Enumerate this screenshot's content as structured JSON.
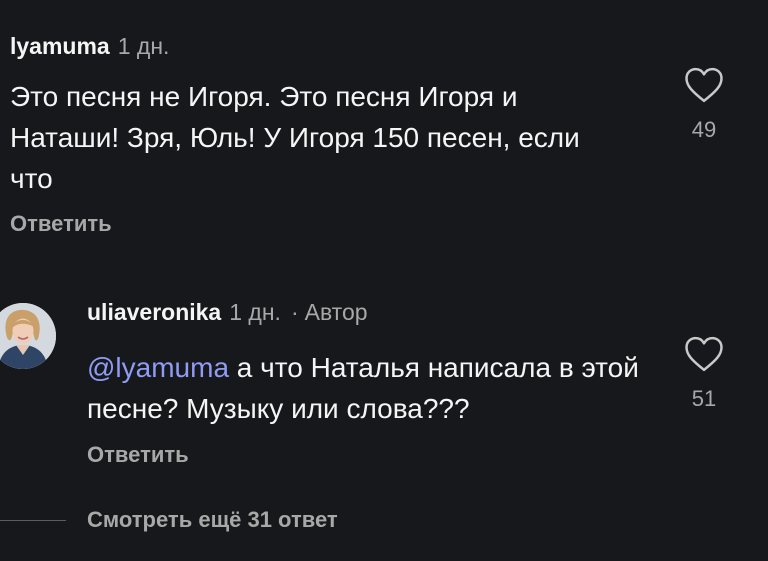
{
  "comments": [
    {
      "username": "lyamuma",
      "time": "1 дн.",
      "text": "Это песня не Игоря. Это песня Игоря и Наташи! Зря, Юль! У Игоря 150 песен, если что",
      "reply_label": "Ответить",
      "likes": "49",
      "icon": "heart-icon"
    },
    {
      "username": "uliaveronika",
      "time": "1 дн.",
      "separator": "·",
      "author_badge": "Автор",
      "mention": "@lyamuma",
      "text": " а что Наталья написала в этой песне? Музыку или слова???",
      "reply_label": "Ответить",
      "likes": "51",
      "icon": "heart-icon",
      "avatar": "avatar-photo"
    }
  ],
  "view_more": {
    "label": "Смотреть ещё 31 ответ"
  },
  "colors": {
    "background": "#17181c",
    "text": "#f5f5f5",
    "secondary": "#a8a8a8",
    "mention": "#8e9cf5"
  }
}
